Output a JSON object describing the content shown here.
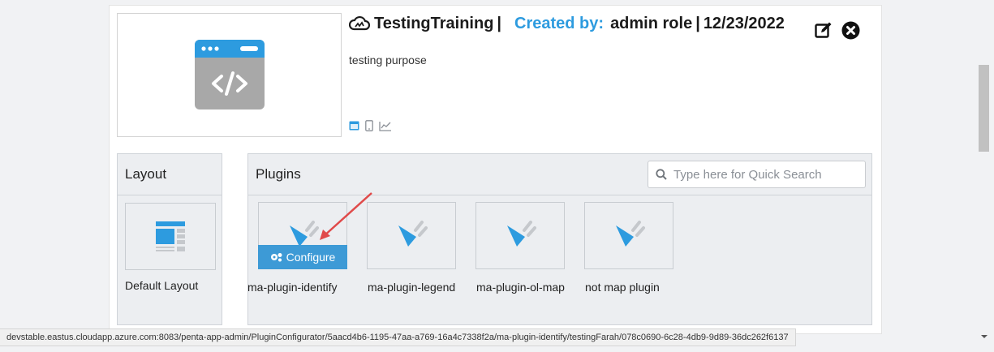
{
  "app": {
    "name": "TestingTraining",
    "created_by_label": "Created by:",
    "created_by": "admin role",
    "date": "12/23/2022",
    "description": "testing purpose"
  },
  "layout_panel": {
    "title": "Layout",
    "tiles": [
      {
        "label": "Default Layout"
      }
    ]
  },
  "plugins_panel": {
    "title": "Plugins",
    "search_placeholder": "Type here for Quick Search",
    "configure_label": "Configure",
    "plugins": [
      {
        "label": "ma-plugin-identify"
      },
      {
        "label": "ma-plugin-legend"
      },
      {
        "label": "ma-plugin-ol-map"
      },
      {
        "label": "not map plugin"
      }
    ]
  },
  "status_bar": {
    "url": "devstable.eastus.cloudapp.azure.com:8083/penta-app-admin/PluginConfigurator/5aacd4b6-1195-47aa-a769-16a4c7338f2a/ma-plugin-identify/testingFarah/078c0690-6c28-4db9-9d89-36dc262f6137"
  },
  "icons": {
    "app_cloud": "cloud-icon",
    "edit": "edit-icon",
    "close": "close-circle-icon",
    "desktop": "desktop-icon",
    "mobile": "mobile-icon",
    "analytics": "chart-line-icon",
    "search": "search-icon",
    "plugin": "plug-icon",
    "configure": "gears-icon",
    "layout": "layout-icon"
  },
  "colors": {
    "accent": "#2d9bdf",
    "configure_bg": "#3d9ad6",
    "arrow": "#e04a4a",
    "panel_bg": "#eceef1"
  }
}
